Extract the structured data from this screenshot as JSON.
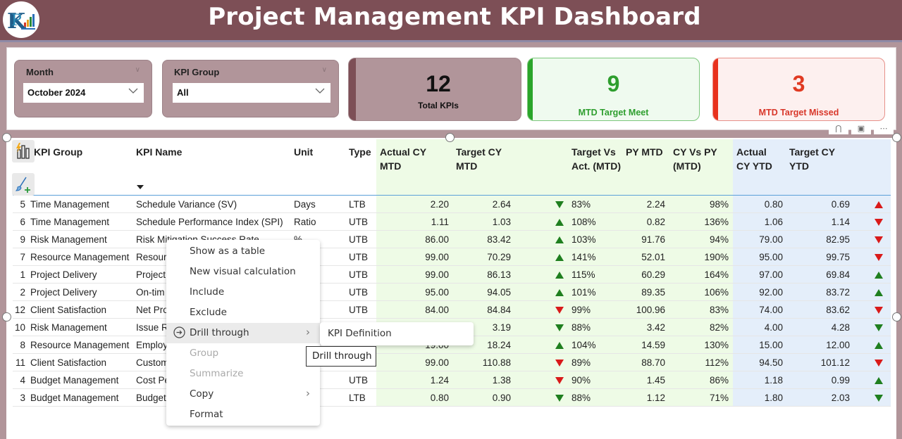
{
  "header": {
    "title": "Project Management KPI Dashboard",
    "logo": "company-logo"
  },
  "slicers": [
    {
      "label": "Month",
      "value": "October 2024"
    },
    {
      "label": "KPI Group",
      "value": "All"
    }
  ],
  "cards": {
    "total": {
      "value": "12",
      "caption": "Total KPIs",
      "color": "#7d4f56"
    },
    "meet": {
      "value": "9",
      "caption": "MTD Target Meet",
      "color": "#2e9e2e"
    },
    "missed": {
      "value": "3",
      "caption": "MTD Target Missed",
      "color": "#e03a22"
    }
  },
  "visual_header_icons": [
    "filter-icon",
    "focus-mode-icon",
    "more-options-icon"
  ],
  "table": {
    "columns": {
      "group": "KPI Group",
      "name": "KPI Name",
      "unit": "Unit",
      "type": "Type",
      "actual_mtd": "Actual CY MTD",
      "target_mtd": "Target CY MTD",
      "tva": "Target Vs Act. (MTD)",
      "py_mtd": "PY MTD",
      "cvp": "CY Vs PY (MTD)",
      "actual_ytd": "Actual CY YTD",
      "target_ytd": "Target CY YTD"
    },
    "rows": [
      {
        "idx": "5",
        "group": "Time Management",
        "name": "Schedule Variance (SV)",
        "unit": "Days",
        "type": "LTB",
        "actual_mtd": "2.20",
        "target_mtd": "2.64",
        "mtd_ind": "down-green",
        "tva": "83%",
        "py_mtd": "2.24",
        "cvp": "98%",
        "actual_ytd": "0.80",
        "target_ytd": "0.69",
        "ytd_ind": "up-red"
      },
      {
        "idx": "6",
        "group": "Time Management",
        "name": "Schedule Performance Index (SPI)",
        "unit": "Ratio",
        "type": "UTB",
        "actual_mtd": "1.11",
        "target_mtd": "1.03",
        "mtd_ind": "up-green",
        "tva": "108%",
        "py_mtd": "0.82",
        "cvp": "136%",
        "actual_ytd": "1.06",
        "target_ytd": "1.14",
        "ytd_ind": "down-red"
      },
      {
        "idx": "9",
        "group": "Risk Management",
        "name": "Risk Mitigation Success Rate",
        "unit": "%",
        "type": "UTB",
        "actual_mtd": "86.00",
        "target_mtd": "83.42",
        "mtd_ind": "up-green",
        "tva": "103%",
        "py_mtd": "91.76",
        "cvp": "94%",
        "actual_ytd": "79.00",
        "target_ytd": "82.95",
        "ytd_ind": "down-red"
      },
      {
        "idx": "7",
        "group": "Resource Management",
        "name": "Resour",
        "unit": "",
        "type": "UTB",
        "actual_mtd": "99.00",
        "target_mtd": "70.29",
        "mtd_ind": "up-green",
        "tva": "141%",
        "py_mtd": "52.01",
        "cvp": "190%",
        "actual_ytd": "95.00",
        "target_ytd": "99.75",
        "ytd_ind": "down-red"
      },
      {
        "idx": "1",
        "group": "Project Delivery",
        "name": "Project",
        "unit": "",
        "type": "UTB",
        "actual_mtd": "99.00",
        "target_mtd": "86.13",
        "mtd_ind": "up-green",
        "tva": "115%",
        "py_mtd": "60.29",
        "cvp": "164%",
        "actual_ytd": "97.00",
        "target_ytd": "69.84",
        "ytd_ind": "up-green"
      },
      {
        "idx": "2",
        "group": "Project Delivery",
        "name": "On-tim",
        "unit": "",
        "type": "UTB",
        "actual_mtd": "95.00",
        "target_mtd": "94.05",
        "mtd_ind": "up-green",
        "tva": "101%",
        "py_mtd": "89.35",
        "cvp": "106%",
        "actual_ytd": "92.00",
        "target_ytd": "83.72",
        "ytd_ind": "up-green"
      },
      {
        "idx": "12",
        "group": "Client Satisfaction",
        "name": "Net Pro",
        "unit": "",
        "type": "UTB",
        "actual_mtd": "84.00",
        "target_mtd": "84.84",
        "mtd_ind": "down-red",
        "tva": "99%",
        "py_mtd": "100.96",
        "cvp": "83%",
        "actual_ytd": "74.00",
        "target_ytd": "83.62",
        "ytd_ind": "down-red"
      },
      {
        "idx": "10",
        "group": "Risk Management",
        "name": "Issue R",
        "unit": "",
        "type": "",
        "actual_mtd": "",
        "target_mtd": "3.19",
        "mtd_ind": "down-green",
        "tva": "88%",
        "py_mtd": "3.42",
        "cvp": "82%",
        "actual_ytd": "4.00",
        "target_ytd": "4.28",
        "ytd_ind": "down-green"
      },
      {
        "idx": "8",
        "group": "Resource Management",
        "name": "Employ",
        "unit": "",
        "type": "",
        "actual_mtd": "19.00",
        "target_mtd": "18.24",
        "mtd_ind": "up-green",
        "tva": "104%",
        "py_mtd": "14.59",
        "cvp": "130%",
        "actual_ytd": "15.00",
        "target_ytd": "12.00",
        "ytd_ind": "up-green"
      },
      {
        "idx": "11",
        "group": "Client Satisfaction",
        "name": "Custom",
        "unit": "",
        "type": "",
        "actual_mtd": "99.00",
        "target_mtd": "110.88",
        "mtd_ind": "down-red",
        "tva": "89%",
        "py_mtd": "88.70",
        "cvp": "112%",
        "actual_ytd": "94.50",
        "target_ytd": "101.12",
        "ytd_ind": "down-red"
      },
      {
        "idx": "4",
        "group": "Budget Management",
        "name": "Cost Pe",
        "unit": "",
        "type": "UTB",
        "actual_mtd": "1.24",
        "target_mtd": "1.38",
        "mtd_ind": "down-red",
        "tva": "90%",
        "py_mtd": "1.45",
        "cvp": "86%",
        "actual_ytd": "1.18",
        "target_ytd": "0.99",
        "ytd_ind": "up-green"
      },
      {
        "idx": "3",
        "group": "Budget Management",
        "name": "Budget",
        "unit": "",
        "type": "LTB",
        "actual_mtd": "0.80",
        "target_mtd": "0.90",
        "mtd_ind": "down-green",
        "tva": "88%",
        "py_mtd": "1.12",
        "cvp": "71%",
        "actual_ytd": "1.80",
        "target_ytd": "2.03",
        "ytd_ind": "down-green"
      }
    ]
  },
  "indicator_colors": {
    "green": "#1f7f1f",
    "red": "#d91a1a"
  },
  "context_menu": {
    "items": [
      {
        "label": "Show as a table",
        "disabled": false,
        "submenu": false
      },
      {
        "label": "New visual calculation",
        "disabled": false,
        "submenu": false
      },
      {
        "label": "Include",
        "disabled": false,
        "submenu": false
      },
      {
        "label": "Exclude",
        "disabled": false,
        "submenu": false
      },
      {
        "label": "Drill through",
        "disabled": false,
        "submenu": true,
        "hover": true,
        "icon": "drill-through-icon"
      },
      {
        "label": "Group",
        "disabled": true,
        "submenu": false
      },
      {
        "label": "Summarize",
        "disabled": true,
        "submenu": false
      },
      {
        "label": "Copy",
        "disabled": false,
        "submenu": true
      },
      {
        "label": "Format",
        "disabled": false,
        "submenu": false
      }
    ],
    "submenu_item": "KPI Definition",
    "tooltip": "Drill through"
  }
}
